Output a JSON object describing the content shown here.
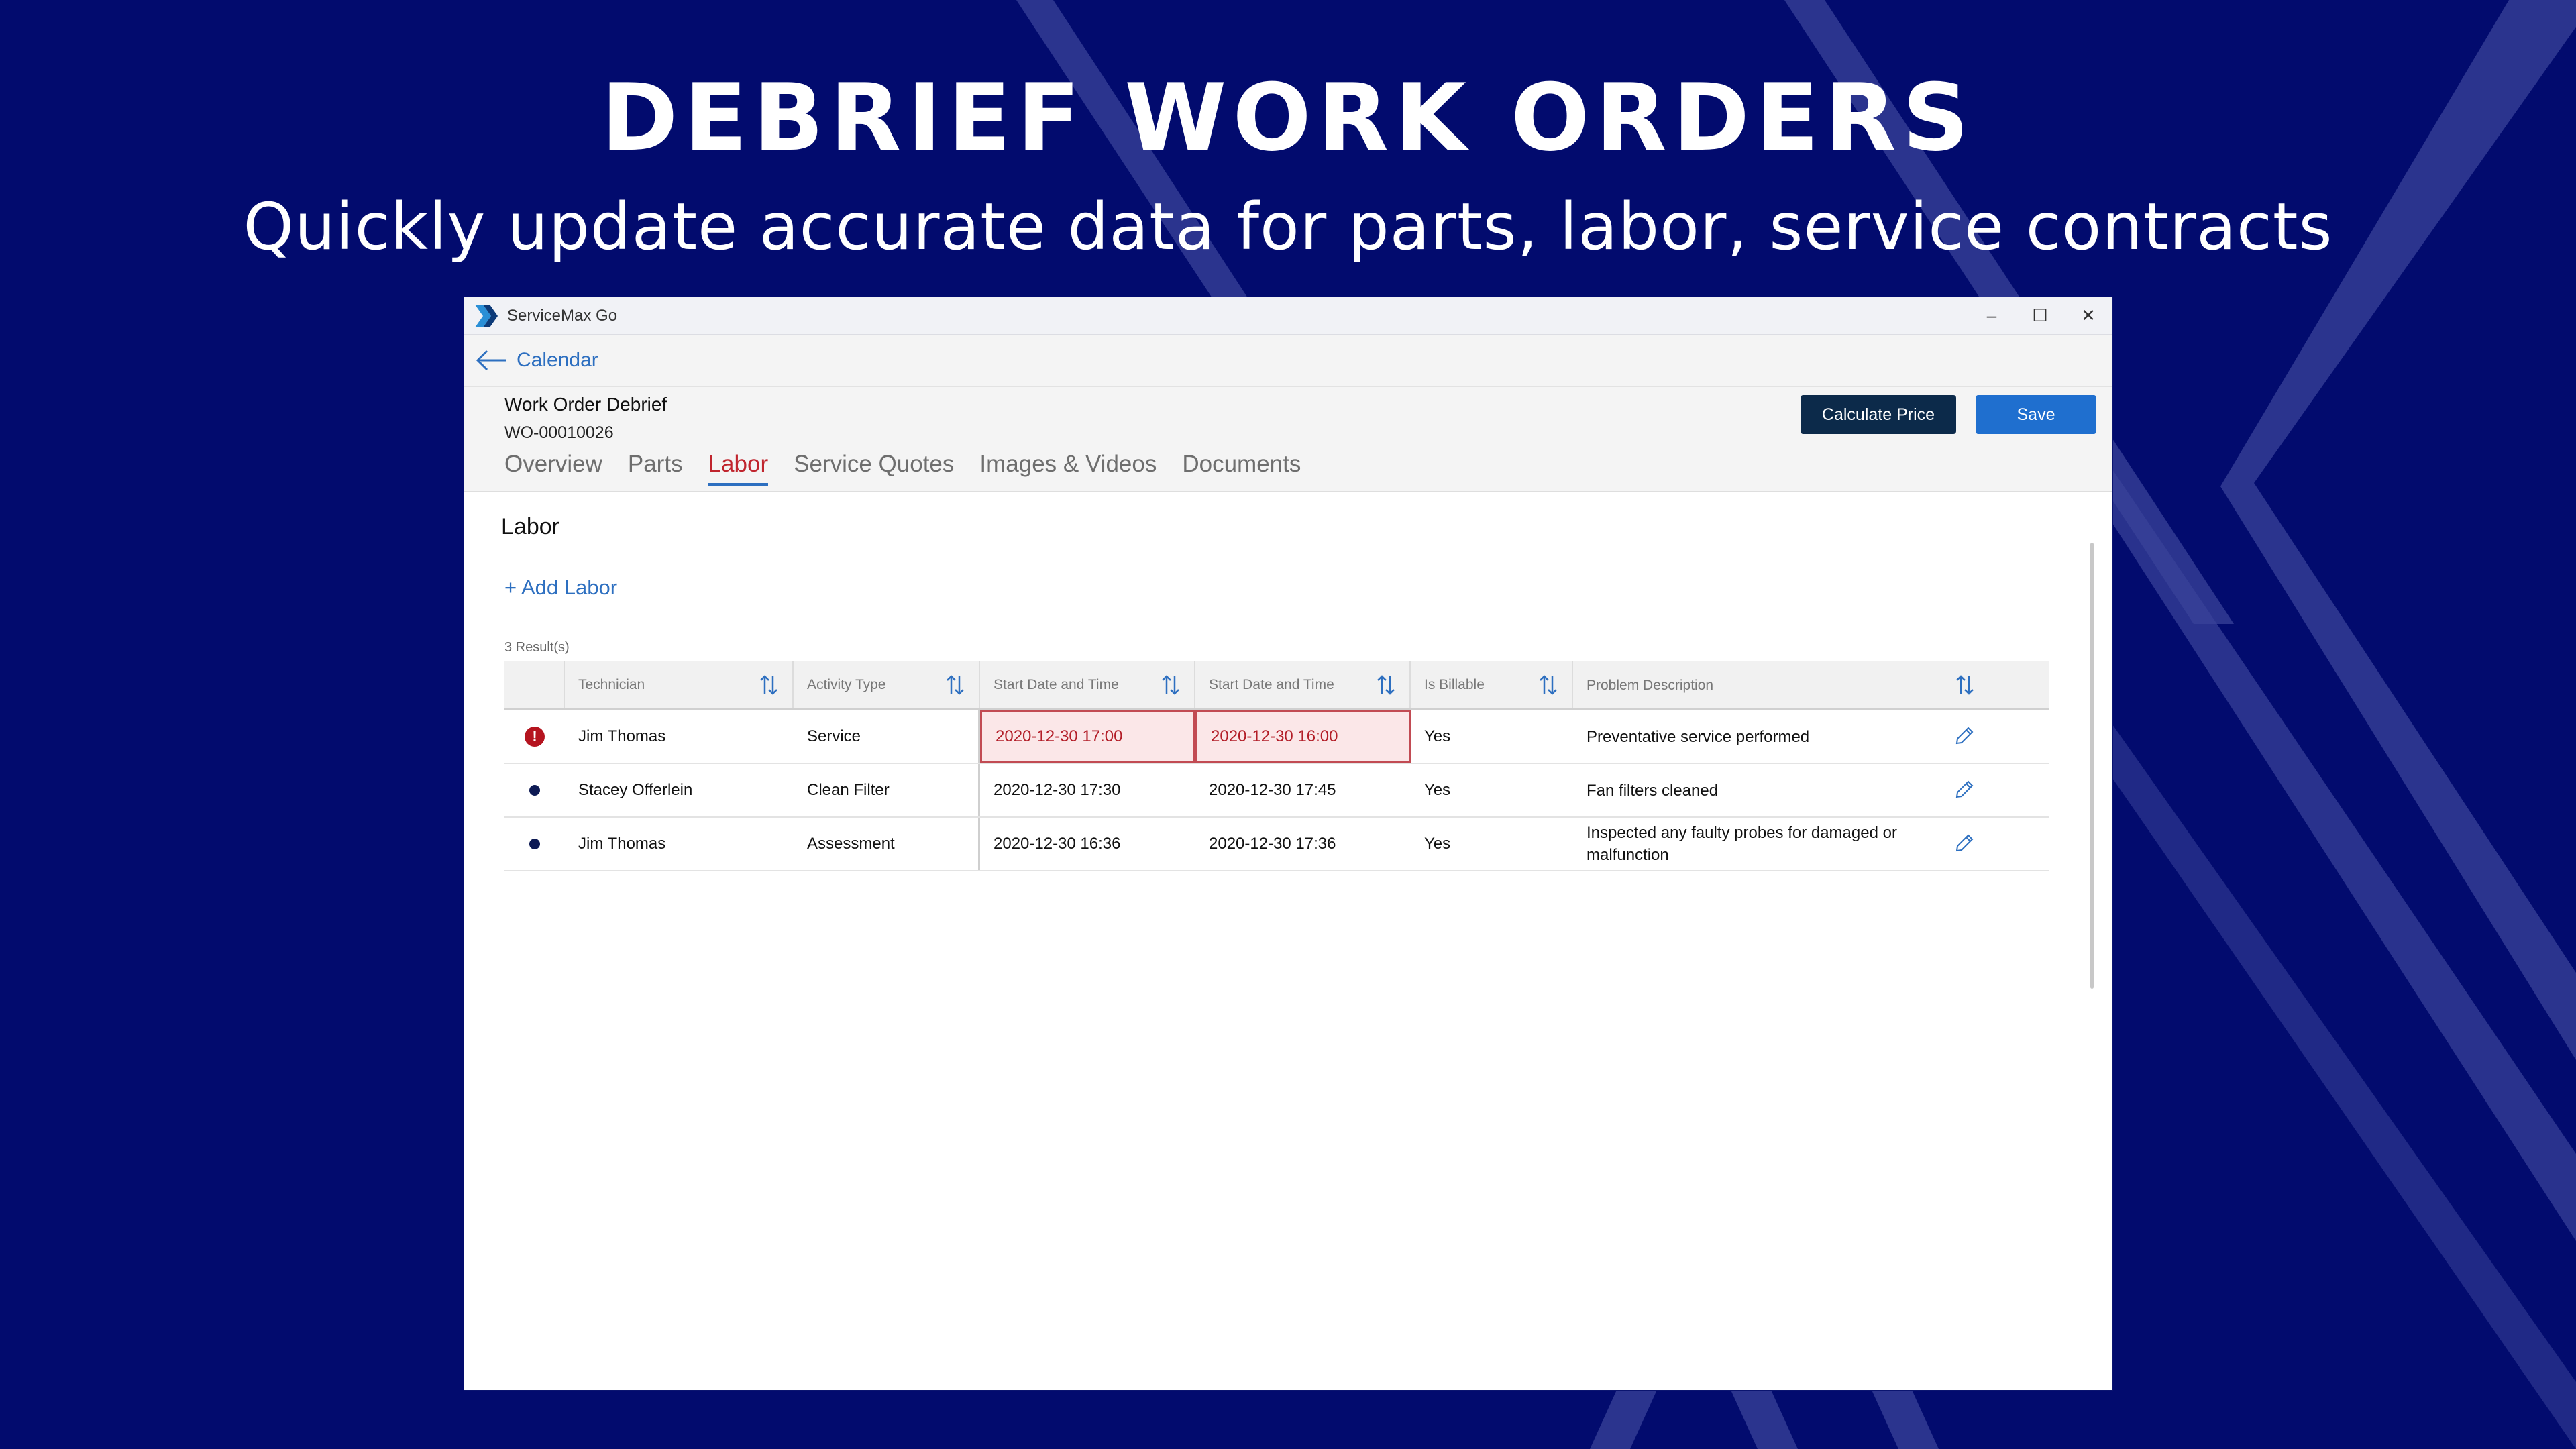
{
  "slide": {
    "headline": "DEBRIEF WORK ORDERS",
    "subline": "Quickly update accurate data for parts, labor, service contracts"
  },
  "window": {
    "app_title": "ServiceMax Go",
    "controls": {
      "minimize": "–",
      "maximize": "☐",
      "close": "✕"
    },
    "back_label": "Calendar",
    "title": "Work Order Debrief",
    "wo_number": "WO-00010026",
    "tabs": [
      {
        "label": "Overview",
        "active": false
      },
      {
        "label": "Parts",
        "active": false
      },
      {
        "label": "Labor",
        "active": true
      },
      {
        "label": "Service Quotes",
        "active": false
      },
      {
        "label": "Images & Videos",
        "active": false
      },
      {
        "label": "Documents",
        "active": false
      }
    ],
    "calculate_label": "Calculate Price",
    "save_label": "Save"
  },
  "labor": {
    "section_title": "Labor",
    "add_label": "+ Add Labor",
    "results": "3 Result(s)",
    "columns": [
      "Technician",
      "Activity Type",
      "Start Date and Time",
      "Start Date and Time",
      "Is Billable",
      "Problem Description"
    ],
    "rows": [
      {
        "status": "error",
        "technician": "Jim Thomas",
        "activity": "Service",
        "start1": "2020-12-30 17:00",
        "start2": "2020-12-30 16:00",
        "billable": "Yes",
        "description": "Preventative service performed"
      },
      {
        "status": "ok",
        "technician": "Stacey Offerlein",
        "activity": "Clean Filter",
        "start1": "2020-12-30 17:30",
        "start2": "2020-12-30 17:45",
        "billable": "Yes",
        "description": "Fan filters cleaned"
      },
      {
        "status": "ok",
        "technician": "Jim Thomas",
        "activity": "Assessment",
        "start1": "2020-12-30 16:36",
        "start2": "2020-12-30 17:36",
        "billable": "Yes",
        "description": "Inspected any faulty probes for damaged or malfunction"
      }
    ]
  },
  "colors": {
    "background": "#020b6e",
    "accent": "#2d6fc0",
    "error": "#b5141f",
    "dark_button": "#0c2a4a"
  }
}
